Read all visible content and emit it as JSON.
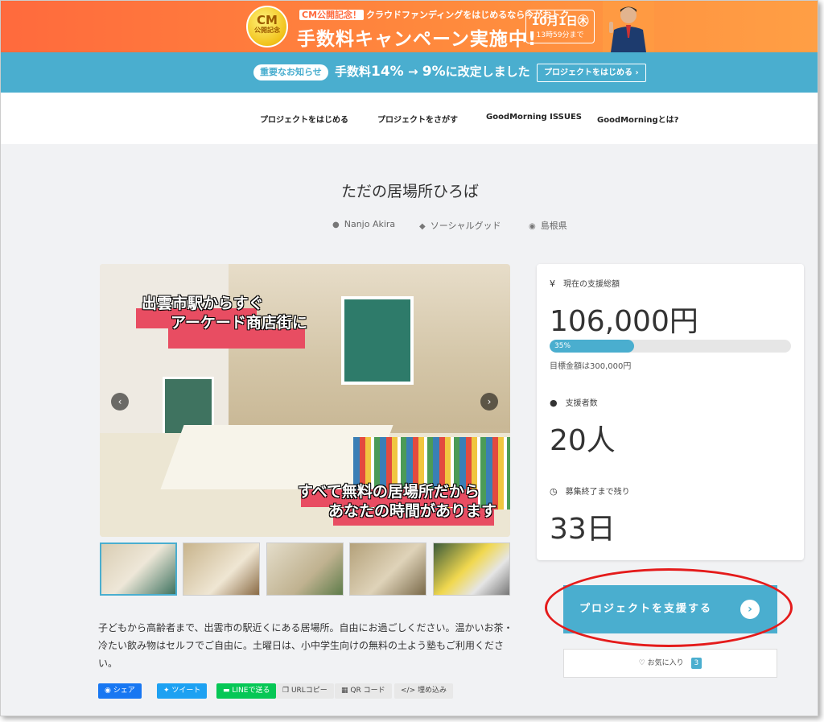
{
  "campaign_banner": {
    "badge_big": "CM",
    "badge_small": "公開記念",
    "subtitle_tag": "CM公開記念！",
    "subtitle": "クラウドファンディングをはじめるなら今がおトク",
    "headline": "手数料キャンペーン実施中!",
    "date_main": "10月1日㊍",
    "date_sub": "13時59分まで"
  },
  "notice": {
    "tag": "重要なお知らせ",
    "text_prefix": "手数料",
    "old_rate": "14%",
    "arrow": "→",
    "new_rate": "9%",
    "text_suffix": "に改定しました",
    "button": "プロジェクトをはじめる ›"
  },
  "nav": {
    "items": [
      "プロジェクトをはじめる",
      "プロジェクトをさがす",
      "GoodMorning ISSUES",
      "GoodMorningとは?"
    ]
  },
  "project": {
    "title": "ただの居場所ひろば",
    "author": "Nanjo Akira",
    "category": "ソーシャルグッド",
    "location": "島根県"
  },
  "gallery": {
    "caption_top_1": "出雲市駅からすぐ",
    "caption_top_2": "アーケード商店街に",
    "caption_bottom_1": "すべて無料の居場所だから",
    "caption_bottom_2": "あなたの時間があります",
    "prev": "‹",
    "next": "›"
  },
  "description": "子どもから高齢者まで、出雲市の駅近くにある居場所。自由にお過ごしください。温かいお茶・冷たい飲み物はセルフでご自由に。土曜日は、小中学生向けの無料の土よう塾もご利用ください。",
  "share": {
    "facebook": "シェア",
    "twitter": "ツイート",
    "line": "LINEで送る",
    "url": "URLコピー",
    "qr": "QR コード",
    "embed": "埋め込み"
  },
  "stats": {
    "amount_label": "現在の支援総額",
    "amount": "106,000円",
    "progress_label": "35%",
    "progress": 0.35,
    "goal": "目標金額は300,000円",
    "backers_label": "支援者数",
    "backers": "20人",
    "remaining_label": "募集終了まで残り",
    "remaining": "33日"
  },
  "actions": {
    "support": "プロジェクトを支援する",
    "favorite": "お気に入り",
    "favorite_count": "3"
  },
  "colors": {
    "accent": "#4aaecf",
    "banner": "#ff7a3d",
    "highlight": "#e41b1b"
  }
}
